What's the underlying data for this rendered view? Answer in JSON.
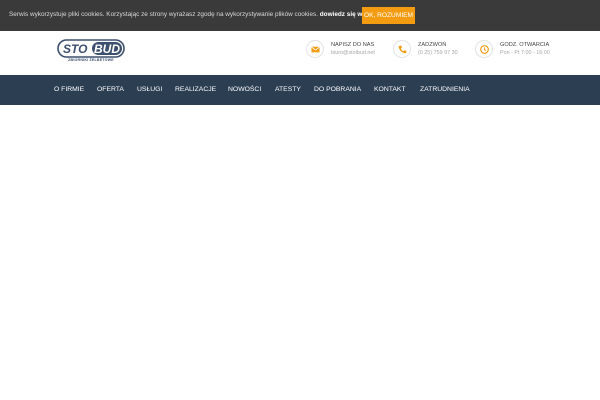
{
  "cookie": {
    "text": "Serwis wykorzystuje pliki cookies. Korzystając ze strony wyrażasz zgodę na wykorzystywanie plików cookies.",
    "more_link": "dowiedz się więcej.",
    "accept_label": "OK, ROZUMIEM"
  },
  "header": {
    "logo_word": "STOLBUD",
    "logo_sub": "ZBIORNIKI ŻELBETOWE",
    "contacts": [
      {
        "icon": "envelope-icon",
        "title": "NAPISZ DO NAS",
        "value": "biuro@stolbud.net"
      },
      {
        "icon": "phone-icon",
        "title": "ZADZWOŃ",
        "value": "(0 25) 759 97 30"
      },
      {
        "icon": "clock-icon",
        "title": "GODZ. OTWARCIA",
        "value": "Pon - Pt 7:00 - 16:00"
      }
    ]
  },
  "nav": {
    "items": [
      "O FIRMIE",
      "OFERTA",
      "USŁUGI",
      "REALIZACJE",
      "NOWOŚCI",
      "ATESTY",
      "DO POBRANIA",
      "KONTAKT",
      "ZATRUDNIENIA"
    ]
  },
  "colors": {
    "cookie_bg": "#3a3a3a",
    "accent": "#f39c12",
    "nav_bg": "#2c3e52"
  }
}
